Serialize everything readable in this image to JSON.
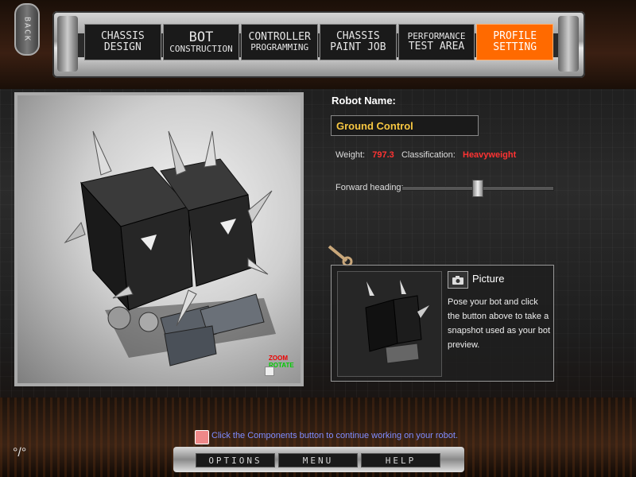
{
  "nav": {
    "back": "BACK",
    "tabs": [
      {
        "line1": "CHASSIS",
        "line2": "DESIGN",
        "active": false
      },
      {
        "line1": "BOT",
        "line2": "CONSTRUCTION",
        "active": false
      },
      {
        "line1": "CONTROLLER",
        "line2": "PROGRAMMING",
        "active": false
      },
      {
        "line1": "CHASSIS",
        "line2": "PAINT JOB",
        "active": false
      },
      {
        "line1": "PERFORMANCE",
        "line2": "TEST AREA",
        "active": false
      },
      {
        "line1": "PROFILE",
        "line2": "SETTING",
        "active": true
      }
    ]
  },
  "viewport": {
    "zoom_label": "ZOOM",
    "rotate_label": "ROTATE"
  },
  "profile": {
    "robot_name_label": "Robot Name:",
    "robot_name_value": "Ground Control",
    "weight_label": "Weight:",
    "weight_value": "797.3",
    "classification_label": "Classification:",
    "classification_value": "Heavyweight",
    "heading_label": "Forward heading:",
    "heading_fraction": 0.5
  },
  "picture": {
    "title": "Picture",
    "description": "Pose your bot and click the button above to take a snapshot used as your bot preview."
  },
  "status": {
    "message": "Click the Components button to continue working on your robot."
  },
  "bottom": {
    "options": "OPTIONS",
    "menu": "MENU",
    "help": "HELP"
  },
  "colors": {
    "accent": "#ff6a00",
    "name_text": "#f7c742",
    "warning_text": "#ff3333",
    "status_text": "#7f8cff"
  }
}
